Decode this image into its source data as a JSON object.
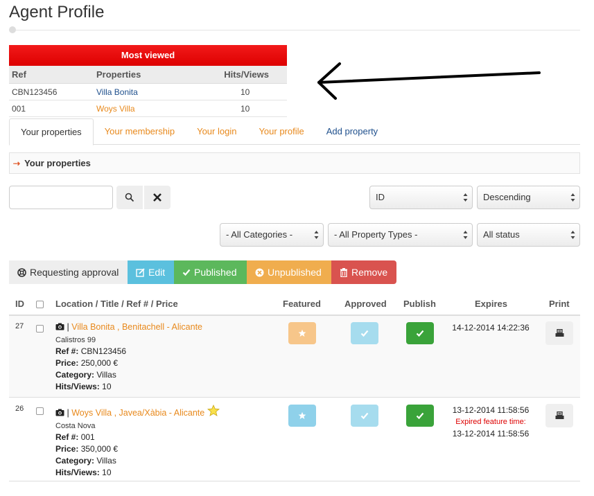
{
  "page": {
    "title": "Agent Profile"
  },
  "most_viewed": {
    "title": "Most viewed",
    "columns": [
      "Ref",
      "Properties",
      "Hits/Views"
    ],
    "rows": [
      {
        "ref": "CBN123456",
        "property": "Villa Bonita",
        "hits": "10"
      },
      {
        "ref": "001",
        "property": "Woys Villa",
        "hits": "10"
      }
    ]
  },
  "tabs": [
    "Your properties",
    "Your membership",
    "Your login",
    "Your profile",
    "Add property"
  ],
  "section": {
    "title": "Your properties"
  },
  "search": {
    "value": "",
    "placeholder": ""
  },
  "sort": {
    "field": "ID",
    "order": "Descending"
  },
  "filters": {
    "category": "- All Categories -",
    "type": "- All Property Types -",
    "status": "All status"
  },
  "status_buttons": {
    "requesting": "Requesting approval",
    "edit": "Edit",
    "published": "Published",
    "unpublished": "Unpublished",
    "remove": "Remove"
  },
  "table": {
    "headers": {
      "id": "ID",
      "location": "Location / Title / Ref # / Price",
      "featured": "Featured",
      "approved": "Approved",
      "publish": "Publish",
      "expires": "Expires",
      "print": "Print"
    },
    "labels": {
      "ref": "Ref #:",
      "price": "Price:",
      "category": "Category:",
      "hits": "Hits/Views:"
    },
    "rows": [
      {
        "id": "27",
        "title": "Villa Bonita , Benitachell - Alicante",
        "address": "Calistros 99",
        "ref": "CBN123456",
        "price": "250,000 €",
        "category": "Villas",
        "hits": "10",
        "expires": "14-12-2014 14:22:36"
      },
      {
        "id": "26",
        "title": "Woys Villa , Javea/Xàbia - Alicante",
        "address": "Costa Nova",
        "ref": "001",
        "price": "350,000 €",
        "category": "Villas",
        "hits": "10",
        "expires": "13-12-2014 11:58:56",
        "expired_note": "Expired feature time:",
        "expired_time": "13-12-2014 11:58:56"
      }
    ]
  },
  "colors": {
    "header_red": "#ee0000",
    "link_orange": "#e8891c",
    "link_blue": "#1e4f8c",
    "edit": "#5bc0de",
    "published": "#5cb85c",
    "unpublished": "#f0ad4e",
    "remove": "#d9534f"
  }
}
